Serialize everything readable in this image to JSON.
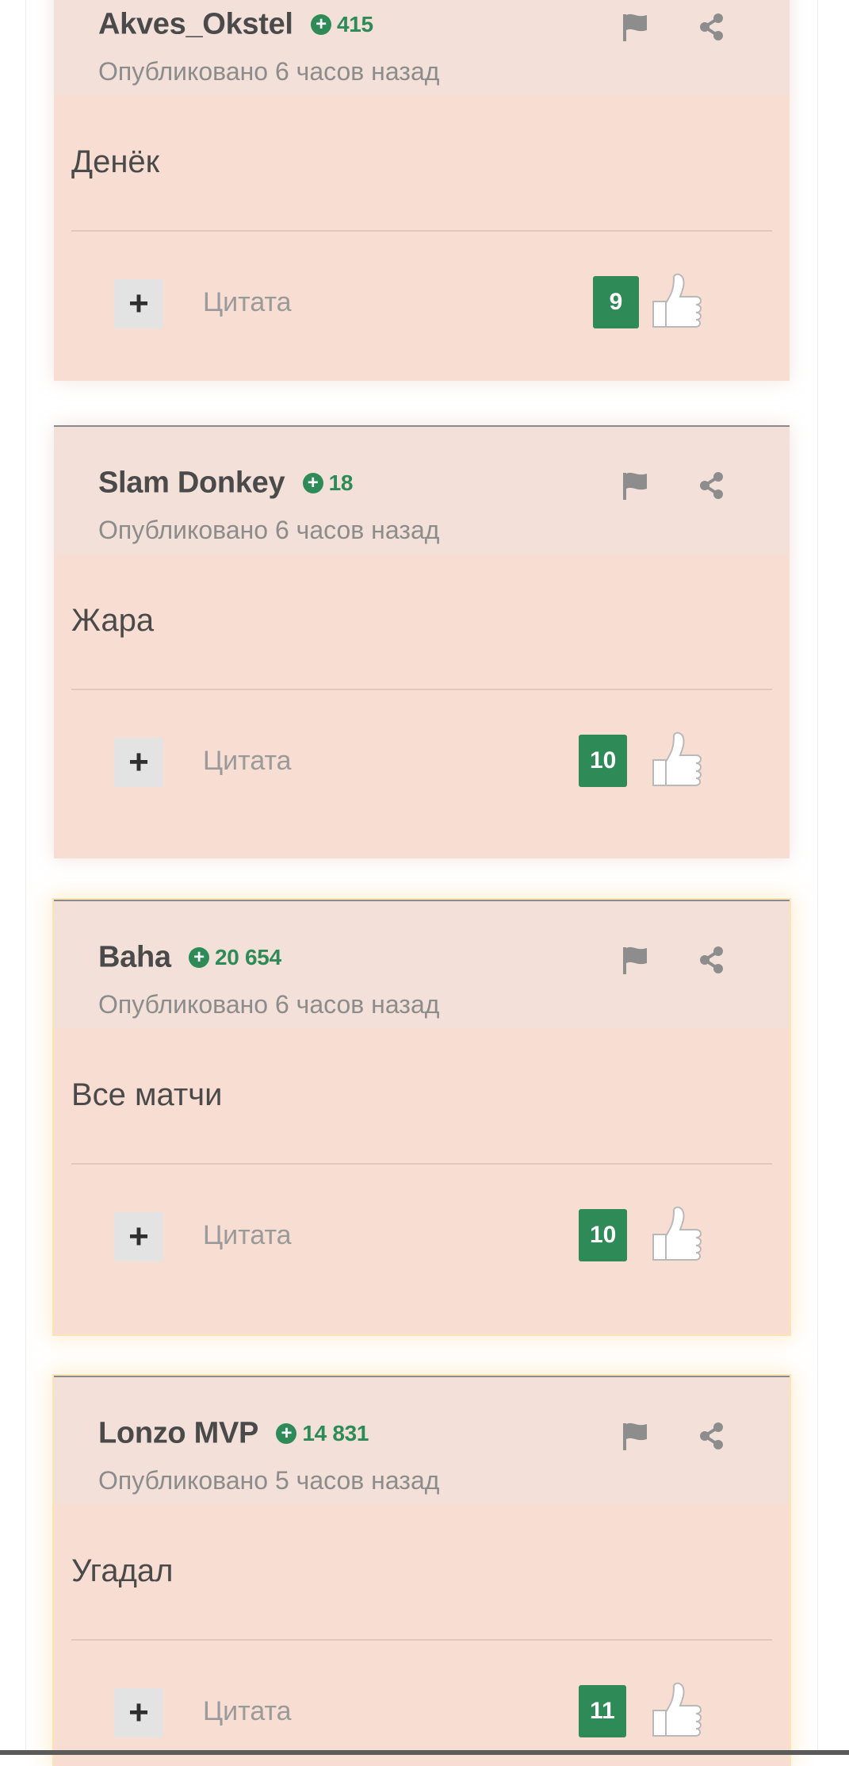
{
  "comments": [
    {
      "author": "Akves_Okstel",
      "rating": "415",
      "posted": "Опубликовано 6 часов назад",
      "text": "Денёк",
      "quote_label": "Цитата",
      "votes": "9",
      "rating_color": "#2e8b57",
      "icons": [
        "flag-icon",
        "share-icon",
        "plus-icon",
        "thumbs-up-icon"
      ]
    },
    {
      "author": "Slam Donkey",
      "rating": "18",
      "posted": "Опубликовано 6 часов назад",
      "text": "Жара",
      "quote_label": "Цитата",
      "votes": "10",
      "rating_color": "#2e8b57",
      "icons": [
        "flag-icon",
        "share-icon",
        "plus-icon",
        "thumbs-up-icon"
      ]
    },
    {
      "author": "Baha",
      "rating": "20 654",
      "posted": "Опубликовано 6 часов назад",
      "text": "Все матчи",
      "quote_label": "Цитата",
      "votes": "10",
      "rating_color": "#2e8b57",
      "icons": [
        "flag-icon",
        "share-icon",
        "plus-icon",
        "thumbs-up-icon"
      ]
    },
    {
      "author": "Lonzo MVP",
      "rating": "14 831",
      "posted": "Опубликовано 5 часов назад",
      "text": "Угадал",
      "quote_label": "Цитата",
      "votes": "11",
      "rating_color": "#2e8b57",
      "icons": [
        "flag-icon",
        "share-icon",
        "plus-icon",
        "thumbs-up-icon"
      ]
    }
  ],
  "colors": {
    "card_bg": "#f7ddd2",
    "header_bg": "#f3e1d9",
    "accent_green": "#2e8b57",
    "text_dark": "#4a4a4a",
    "text_muted": "#8c8c8c"
  }
}
